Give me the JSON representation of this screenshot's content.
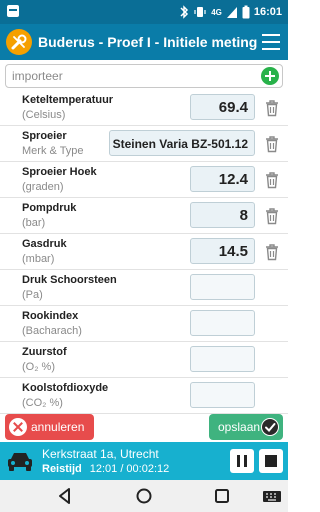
{
  "status_bar": {
    "time": "16:01",
    "signal": "4G"
  },
  "app_bar": {
    "title": "Buderus - Proef I - Initiele meting"
  },
  "search": {
    "placeholder": "importeer",
    "value": ""
  },
  "measurements": [
    {
      "name": "Keteltemperatuur",
      "unit": "(Celsius)",
      "value": "69.4",
      "deletable": true
    },
    {
      "name": "Sproeier",
      "unit": "Merk & Type",
      "value": "Steinen Varia BZ-501.12",
      "deletable": true
    },
    {
      "name": "Sproeier Hoek",
      "unit": "(graden)",
      "value": "12.4",
      "deletable": true
    },
    {
      "name": "Pompdruk",
      "unit": "(bar)",
      "value": "8",
      "deletable": true
    },
    {
      "name": "Gasdruk",
      "unit": "(mbar)",
      "value": "14.5",
      "deletable": true
    },
    {
      "name": "Druk Schoorsteen",
      "unit": "(Pa)",
      "value": "",
      "deletable": false
    },
    {
      "name": "Rookindex",
      "unit": "(Bacharach)",
      "value": "",
      "deletable": false
    },
    {
      "name": "Zuurstof",
      "unit": "(O₂ %)",
      "value": "",
      "deletable": false
    },
    {
      "name": "Koolstofdioxyde",
      "unit": "(CO₂ %)",
      "value": "",
      "deletable": false
    }
  ],
  "actions": {
    "cancel_label": "annuleren",
    "save_label": "opslaan"
  },
  "trip": {
    "address": "Kerkstraat 1a, Utrecht",
    "label": "Reistijd",
    "clock": "12:01 / 00:02:12"
  },
  "colors": {
    "status_bar": "#0a6e96",
    "app_bar": "#0a7ca8",
    "cancel": "#e74c4c",
    "save": "#3fb37f",
    "trip_bar": "#17b0cf",
    "add": "#28b24a"
  },
  "icons": {
    "app_logo": "wrench-screwdriver-icon",
    "menu": "hamburger-menu-icon",
    "add": "plus-circle-icon",
    "delete": "trash-icon",
    "cancel": "close-circle-icon",
    "save": "check-circle-icon",
    "trip": "car-icon"
  }
}
